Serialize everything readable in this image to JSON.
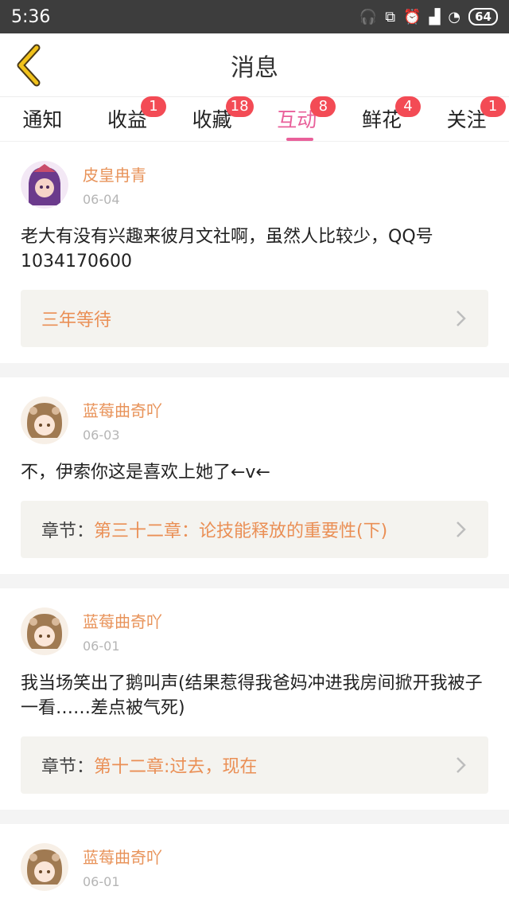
{
  "status_bar": {
    "time": "5:36",
    "battery": "64"
  },
  "header": {
    "title": "消息"
  },
  "tabs": [
    {
      "label": "通知",
      "badge": ""
    },
    {
      "label": "收益",
      "badge": "1"
    },
    {
      "label": "收藏",
      "badge": "18"
    },
    {
      "label": "互动",
      "badge": "8"
    },
    {
      "label": "鲜花",
      "badge": "4"
    },
    {
      "label": "关注",
      "badge": "1"
    }
  ],
  "messages": [
    {
      "user": "皮皇冉青",
      "date": "06-04",
      "content": "老大有没有兴趣来彼月文社啊，虽然人比较少，QQ号1034170600",
      "ref_label": "",
      "ref_text": "三年等待"
    },
    {
      "user": "蓝莓曲奇吖",
      "date": "06-03",
      "content": "不，伊索你这是喜欢上她了←v←",
      "ref_label": "章节：",
      "ref_text": "第三十二章：论技能释放的重要性(下)"
    },
    {
      "user": "蓝莓曲奇吖",
      "date": "06-01",
      "content": "我当场笑出了鹅叫声(结果惹得我爸妈冲进我房间掀开我被子一看……差点被气死)",
      "ref_label": "章节：",
      "ref_text": "第十二章:过去，现在"
    },
    {
      "user": "蓝莓曲奇吖",
      "date": "06-01",
      "content": "",
      "ref_label": "",
      "ref_text": ""
    }
  ],
  "colors": {
    "accent": "#e9609a",
    "username": "#e8935a",
    "badge": "#f34b55"
  }
}
